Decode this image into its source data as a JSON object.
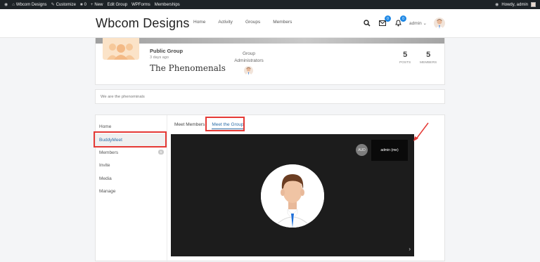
{
  "adminbar": {
    "site": "Wbcom Designs",
    "customize": "Customize",
    "comments": "0",
    "new": "New",
    "edit_group": "Edit Group",
    "wpforms": "WPForms",
    "memberships": "Memberships",
    "howdy": "Howdy, admin"
  },
  "header": {
    "logo": "Wbcom Designs",
    "nav": [
      "Home",
      "Activity",
      "Groups",
      "Members"
    ],
    "messages_count": "0",
    "notifications_count": "0",
    "user": "admin"
  },
  "group": {
    "type": "Public Group",
    "time": "3 days ago",
    "name": "The Phenomenals",
    "admins_label_1": "Group",
    "admins_label_2": "Administrators",
    "stat_posts": "5",
    "stat_posts_label": "POSTS",
    "stat_members": "5",
    "stat_members_label": "MEMBERS",
    "description": "We are the phenominals"
  },
  "sidebar": {
    "items": [
      {
        "label": "Home"
      },
      {
        "label": "BuddyMeet"
      },
      {
        "label": "Members",
        "count": "5"
      },
      {
        "label": "Invite"
      },
      {
        "label": "Media"
      },
      {
        "label": "Manage"
      }
    ]
  },
  "tabs": {
    "meet_members": "Meet Members",
    "meet_group": "Meet the Group"
  },
  "video": {
    "aud": "AUD",
    "thumb_name": "admin (me)"
  },
  "colors": {
    "highlight": "#e53935",
    "accent": "#2c6ea8",
    "badge": "#1e88e5"
  }
}
